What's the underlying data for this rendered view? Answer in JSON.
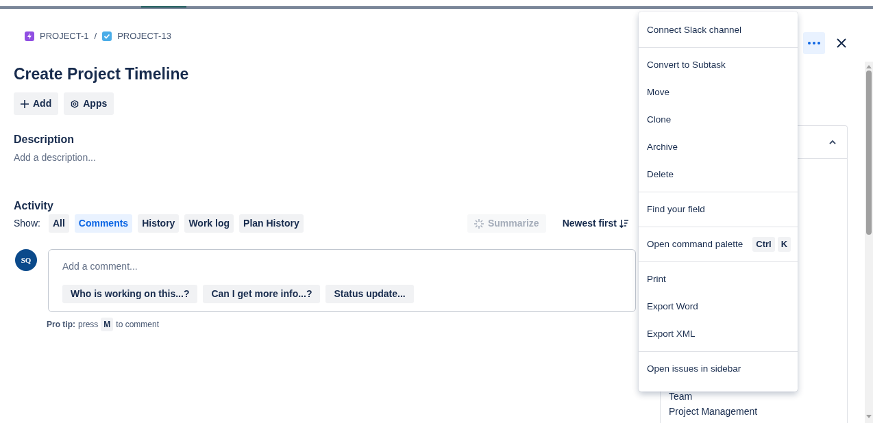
{
  "breadcrumbs": [
    {
      "label": "PROJECT-1",
      "kind": "epic"
    },
    {
      "label": "PROJECT-13",
      "kind": "task"
    }
  ],
  "separator": "/",
  "title": "Create Project Timeline",
  "actions": [
    {
      "label": "Add",
      "kind": "add"
    },
    {
      "label": "Apps",
      "kind": "apps"
    }
  ],
  "description": {
    "heading": "Description",
    "placeholder": "Add a description..."
  },
  "activity": {
    "heading": "Activity",
    "show_label": "Show:",
    "filters": [
      {
        "label": "All",
        "selected": false
      },
      {
        "label": "Comments",
        "selected": true
      },
      {
        "label": "History",
        "selected": false
      },
      {
        "label": "Work log",
        "selected": false
      },
      {
        "label": "Plan History",
        "selected": false
      }
    ],
    "summarize": {
      "label": "Summarize",
      "disabled": true
    },
    "sort": "Newest first"
  },
  "comment": {
    "avatar": "SQ",
    "placeholder": "Add a comment...",
    "suggestions": [
      "Who is working on this...?",
      "Can I get more info...?",
      "Status update..."
    ],
    "tip_label": "Pro tip:",
    "tip_before": "press",
    "tip_key": "M",
    "tip_after": "to comment"
  },
  "side_panel": {
    "expanded": true,
    "items": [
      "Team",
      "Project Management"
    ]
  },
  "more_button": {
    "expanded": true
  },
  "menu": {
    "groups": [
      [
        {
          "label": "Connect Slack channel"
        }
      ],
      [
        {
          "label": "Convert to Subtask"
        },
        {
          "label": "Move"
        },
        {
          "label": "Clone"
        },
        {
          "label": "Archive"
        },
        {
          "label": "Delete"
        }
      ],
      [
        {
          "label": "Find your field"
        }
      ],
      [
        {
          "label": "Open command palette",
          "keys": [
            "Ctrl",
            "K"
          ]
        }
      ],
      [
        {
          "label": "Print"
        },
        {
          "label": "Export Word"
        },
        {
          "label": "Export XML"
        }
      ],
      [
        {
          "label": "Open issues in sidebar"
        }
      ]
    ]
  }
}
